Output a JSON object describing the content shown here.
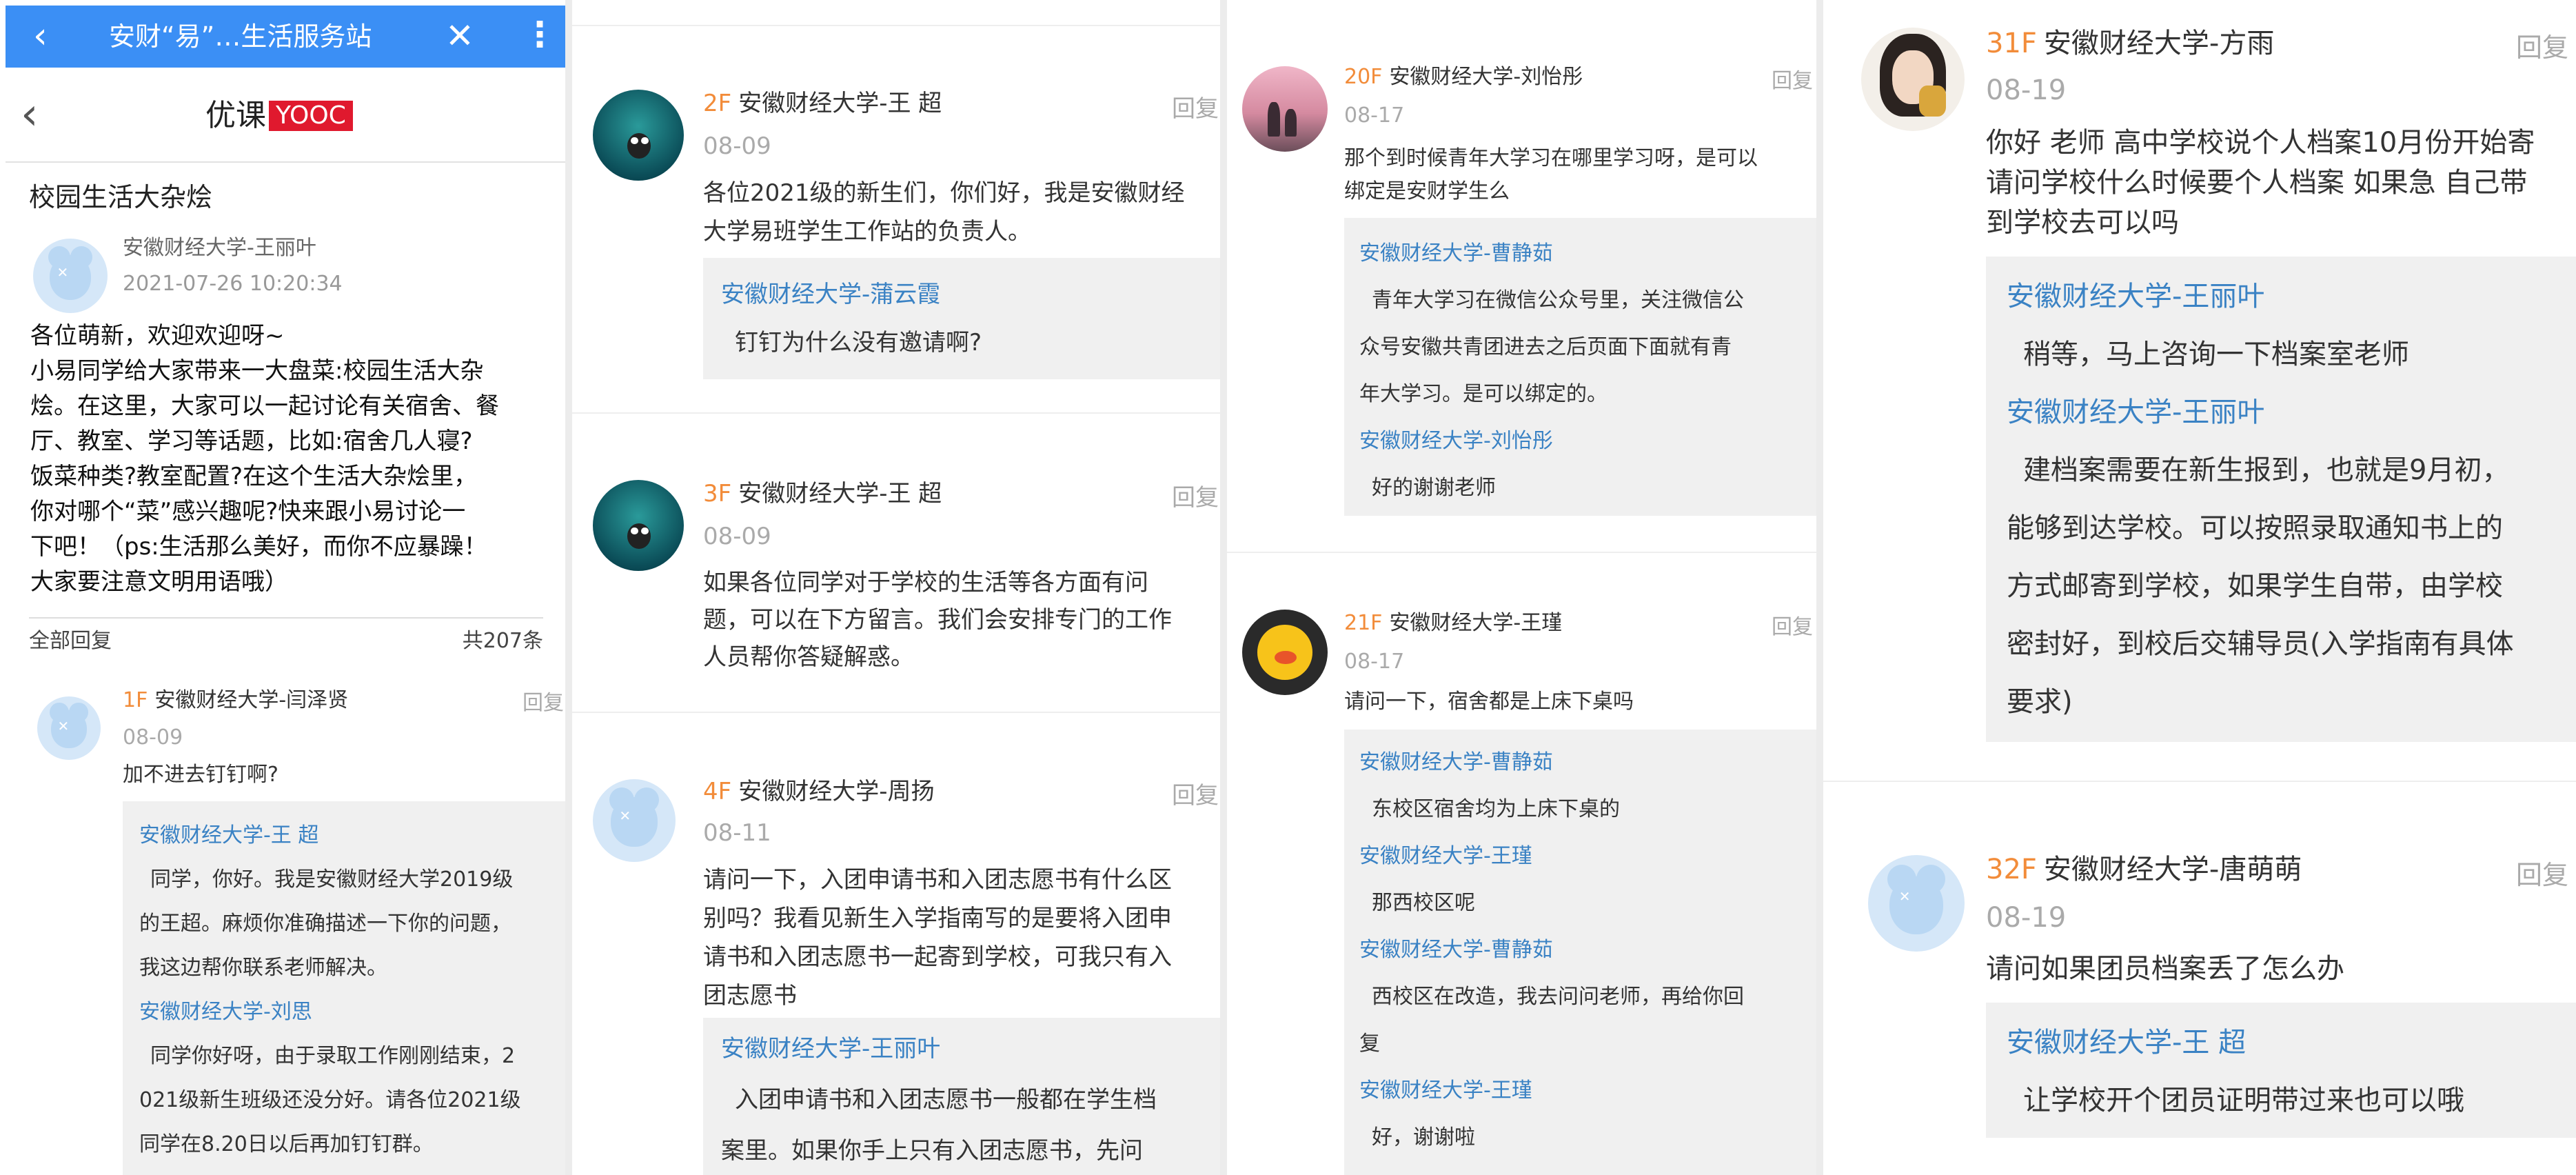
{
  "panel1": {
    "title": "安财“易”…生活服务站",
    "back_glyph": "‹",
    "close_glyph": "✕",
    "more_glyph": "⋮",
    "logo_text": "优课",
    "logo_badge": "YOOC",
    "topic_title": "校园生活大杂烩",
    "op_name": "安徽财经大学-王丽叶",
    "op_time": "2021-07-26 10:20:34",
    "post_lines": [
      "各位萌新，欢迎欢迎呀~",
      "小易同学给大家带来一大盘菜:校园生活大杂",
      "烩。在这里，大家可以一起讨论有关宿舍、餐",
      "厅、教室、学习等话题，比如:宿舍几人寝?",
      "饭菜种类?教室配置?在这个生活大杂烩里，",
      "你对哪个“菜”感兴趣呢?快来跟小易讨论一",
      "下吧！（ps:生活那么美好，而你不应暴躁！",
      "大家要注意文明用语哦）"
    ],
    "all_replies_label": "全部回复",
    "reply_count": "共207条",
    "floor1": {
      "floor": "1F",
      "name": "安徽财经大学-闫泽贤",
      "date": "08-09",
      "reply": "回复",
      "text": "加不进去钉钉啊?",
      "subs": [
        {
          "name": "安徽财经大学-王 超",
          "lines": [
            "同学，你好。我是安徽财经大学2019级",
            "的王超。麻烦你准确描述一下你的问题，",
            "我这边帮你联系老师解决。"
          ]
        },
        {
          "name": "安徽财经大学-刘思",
          "lines": [
            "同学你好呀，由于录取工作刚刚结束，2",
            "021级新生班级还没分好。请各位2021级",
            "同学在8.20日以后再加钉钉群。"
          ]
        }
      ]
    }
  },
  "panel2": {
    "floors": [
      {
        "floor": "2F",
        "name": "安徽财经大学-王 超",
        "date": "08-09",
        "reply": "回复",
        "text": [
          "各位2021级的新生们，你们好，我是安徽财经",
          "大学易班学生工作站的负责人。"
        ],
        "subs": [
          {
            "name": "安徽财经大学-蒲云霞",
            "lines": [
              "钉钉为什么没有邀请啊?"
            ]
          }
        ]
      },
      {
        "floor": "3F",
        "name": "安徽财经大学-王 超",
        "date": "08-09",
        "reply": "回复",
        "text": [
          "如果各位同学对于学校的生活等各方面有问",
          "题，可以在下方留言。我们会安排专门的工作",
          "人员帮你答疑解惑。"
        ],
        "subs": []
      },
      {
        "floor": "4F",
        "name": "安徽财经大学-周扬",
        "date": "08-11",
        "reply": "回复",
        "text": [
          "请问一下，入团申请书和入团志愿书有什么区",
          "别吗？我看见新生入学指南写的是要将入团申",
          "请书和入团志愿书一起寄到学校，可我只有入",
          "团志愿书"
        ],
        "subs": [
          {
            "name": "安徽财经大学-王丽叶",
            "lines": [
              "入团申请书和入团志愿书一般都在学生档",
              "案里。如果你手上只有入团志愿书，先问"
            ]
          }
        ]
      }
    ]
  },
  "panel3": {
    "floors": [
      {
        "floor": "20F",
        "name": "安徽财经大学-刘怡彤",
        "date": "08-17",
        "reply": "回复",
        "text": [
          "那个到时候青年大学习在哪里学习呀，是可以",
          "绑定是安财学生么"
        ],
        "subs": [
          {
            "name": "安徽财经大学-曹静茹",
            "lines": [
              "青年大学习在微信公众号里，关注微信公",
              "众号安徽共青团进去之后页面下面就有青",
              "年大学习。是可以绑定的。"
            ]
          },
          {
            "name": "安徽财经大学-刘怡彤",
            "lines": [
              "好的谢谢老师"
            ]
          }
        ]
      },
      {
        "floor": "21F",
        "name": "安徽财经大学-王瑾",
        "date": "08-17",
        "reply": "回复",
        "text": [
          "请问一下，宿舍都是上床下桌吗"
        ],
        "subs": [
          {
            "name": "安徽财经大学-曹静茹",
            "lines": [
              "东校区宿舍均为上床下桌的"
            ]
          },
          {
            "name": "安徽财经大学-王瑾",
            "lines": [
              "那西校区呢"
            ]
          },
          {
            "name": "安徽财经大学-曹静茹",
            "lines": [
              "西校区在改造，我去问问老师，再给你回",
              "复"
            ]
          },
          {
            "name": "安徽财经大学-王瑾",
            "lines": [
              "好，谢谢啦"
            ]
          }
        ]
      }
    ]
  },
  "panel4": {
    "floors": [
      {
        "floor": "31F",
        "name": "安徽财经大学-方雨",
        "date": "08-19",
        "reply": "回复",
        "text": [
          "你好 老师 高中学校说个人档案10月份开始寄",
          "请问学校什么时候要个人档案 如果急 自己带",
          "到学校去可以吗"
        ],
        "subs": [
          {
            "name": "安徽财经大学-王丽叶",
            "lines": [
              "稍等，马上咨询一下档案室老师"
            ]
          },
          {
            "name": "安徽财经大学-王丽叶",
            "lines": [
              "建档案需要在新生报到，也就是9月初，",
              "能够到达学校。可以按照录取通知书上的",
              "方式邮寄到学校，如果学生自带，由学校",
              "密封好，到校后交辅导员(入学指南有具体",
              "要求)"
            ]
          }
        ]
      },
      {
        "floor": "32F",
        "name": "安徽财经大学-唐萌萌",
        "date": "08-19",
        "reply": "回复",
        "text": [
          "请问如果团员档案丢了怎么办"
        ],
        "subs": [
          {
            "name": "安徽财经大学-王 超",
            "lines": [
              "让学校开个团员证明带过来也可以哦"
            ]
          }
        ]
      }
    ]
  }
}
